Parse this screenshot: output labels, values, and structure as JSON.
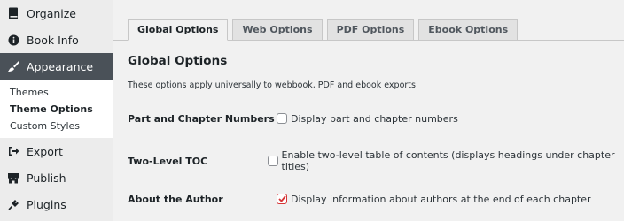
{
  "sidebar": {
    "items": [
      {
        "label": "Organize",
        "icon": "book-icon"
      },
      {
        "label": "Book Info",
        "icon": "info-icon"
      },
      {
        "label": "Appearance",
        "icon": "brush-icon",
        "active": true
      }
    ],
    "submenu": [
      {
        "label": "Themes"
      },
      {
        "label": "Theme Options",
        "current": true
      },
      {
        "label": "Custom Styles"
      }
    ],
    "items_after": [
      {
        "label": "Export",
        "icon": "export-icon"
      },
      {
        "label": "Publish",
        "icon": "store-icon"
      },
      {
        "label": "Plugins",
        "icon": "plugin-icon"
      }
    ]
  },
  "tabs": [
    {
      "label": "Global Options",
      "active": true
    },
    {
      "label": "Web Options"
    },
    {
      "label": "PDF Options"
    },
    {
      "label": "Ebook Options"
    }
  ],
  "section": {
    "title": "Global Options",
    "description": "These options apply universally to webbook, PDF and ebook exports."
  },
  "options": [
    {
      "label": "Part and Chapter Numbers",
      "checkbox_label": "Display part and chapter numbers",
      "checked": false
    },
    {
      "label": "Two-Level TOC",
      "checkbox_label": "Enable two-level table of contents (displays headings under chapter titles)",
      "checked": false
    },
    {
      "label": "About the Author",
      "checkbox_label": "Display information about authors at the end of each chapter",
      "checked": true
    }
  ],
  "colors": {
    "active_menu_bg": "#4a5158",
    "checkbox_checked": "#d63638"
  }
}
